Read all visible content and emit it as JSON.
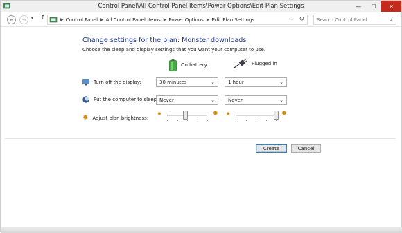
{
  "window": {
    "title": "Control Panel\\All Control Panel Items\\Power Options\\Edit Plan Settings",
    "minimize_glyph": "—",
    "maximize_glyph": "☐",
    "close_glyph": "✕"
  },
  "addressbar": {
    "back_glyph": "←",
    "forward_glyph": "→",
    "recent_glyph": "▾",
    "up_glyph": "↑",
    "breadcrumbs": [
      "Control Panel",
      "All Control Panel Items",
      "Power Options",
      "Edit Plan Settings"
    ],
    "separator": "▶",
    "dropdown_glyph": "▾",
    "refresh_glyph": "↻",
    "search_placeholder": "Search Control Panel",
    "search_glyph": "⌕"
  },
  "plan": {
    "heading": "Change settings for the plan: Monster downloads",
    "description": "Choose the sleep and display settings that you want your computer to use.",
    "on_battery_label": "On battery",
    "plugged_in_label": "Plugged in"
  },
  "settings": {
    "display": {
      "label": "Turn off the display:",
      "battery_value": "30 minutes",
      "plugged_value": "1 hour"
    },
    "sleep": {
      "label": "Put the computer to sleep:",
      "battery_value": "Never",
      "plugged_value": "Never"
    },
    "brightness": {
      "label": "Adjust plan brightness:",
      "battery_level": 0.45,
      "plugged_level": 1.0
    },
    "chevron": "⌄"
  },
  "buttons": {
    "create": "Create",
    "cancel": "Cancel"
  },
  "icons": {
    "sun_small": "✹",
    "sun_large": "✹"
  }
}
